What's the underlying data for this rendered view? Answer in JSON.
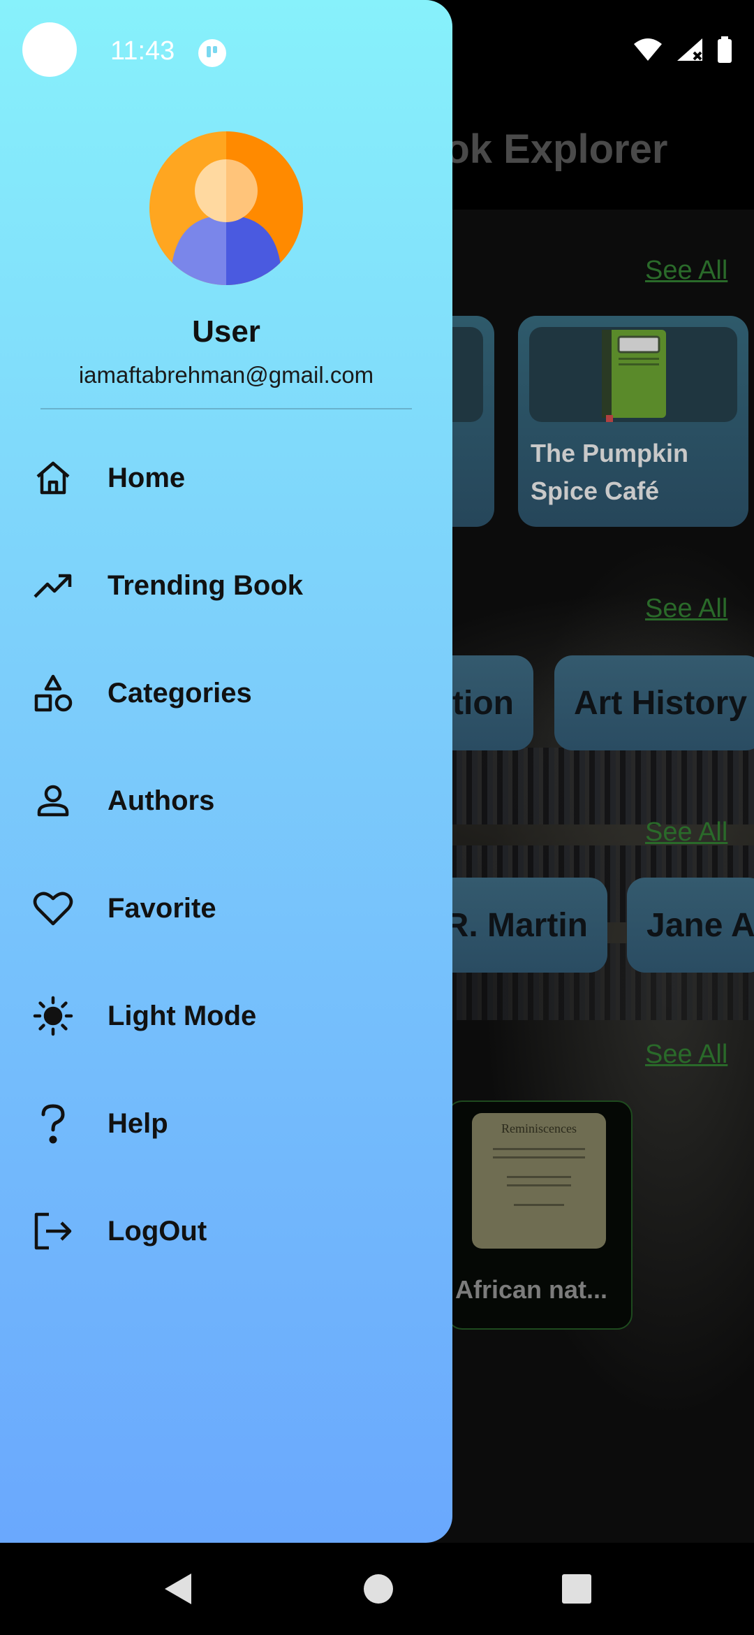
{
  "status_bar": {
    "time": "11:43"
  },
  "app": {
    "title": "Book Explorer",
    "see_all_labels": [
      "See All",
      "See All",
      "See All",
      "See All"
    ],
    "book_card_title": "The Pumpkin Spice Café",
    "category_chips": [
      "Fiction",
      "Art History"
    ],
    "author_chips": [
      "George R. R. Martin",
      "Jane Austen"
    ],
    "bottom_book": {
      "cover_title": "Reminiscences",
      "title": "African nat..."
    }
  },
  "drawer": {
    "user_name": "User",
    "user_email": "iamaftabrehman@gmail.com",
    "items": [
      {
        "label": "Home",
        "icon": "home-icon"
      },
      {
        "label": "Trending Book",
        "icon": "trending-up-icon"
      },
      {
        "label": "Categories",
        "icon": "shapes-icon"
      },
      {
        "label": "Authors",
        "icon": "person-icon"
      },
      {
        "label": "Favorite",
        "icon": "heart-icon"
      },
      {
        "label": "Light Mode",
        "icon": "sun-icon"
      },
      {
        "label": "Help",
        "icon": "question-icon"
      },
      {
        "label": "LogOut",
        "icon": "logout-icon"
      }
    ]
  },
  "colors": {
    "drawer_top": "#87f1fb",
    "drawer_bottom": "#6aa8fd",
    "see_all": "#2a6a2a"
  }
}
